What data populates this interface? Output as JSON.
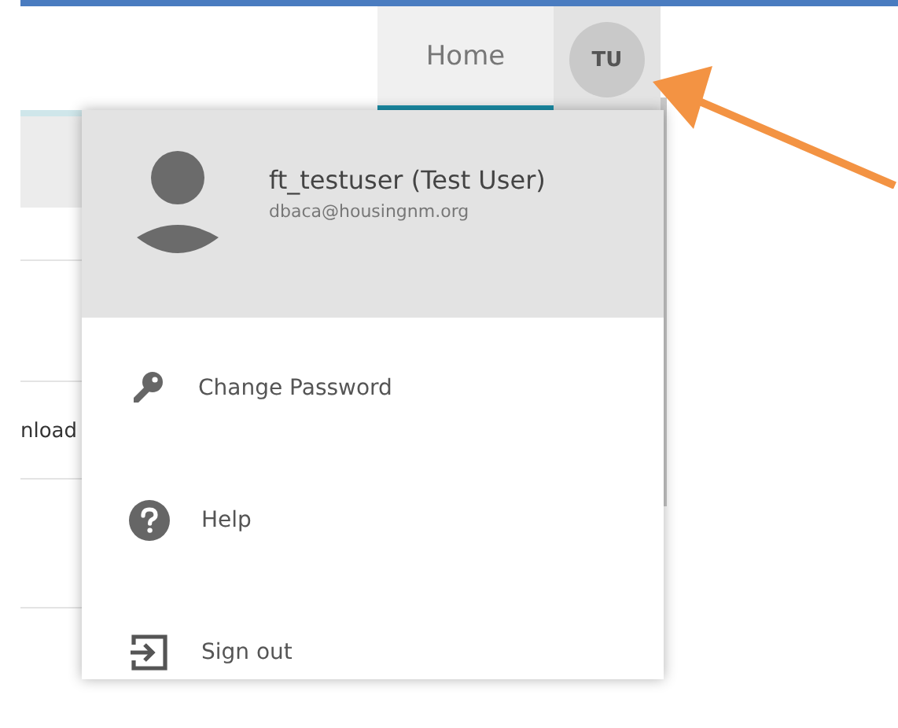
{
  "nav": {
    "tabs": [
      {
        "label": "Home",
        "selected": true
      }
    ],
    "avatar": {
      "initials": "TU"
    }
  },
  "background": {
    "row_text": "nload"
  },
  "user_menu": {
    "name": "ft_testuser (Test User)",
    "email": "dbaca@housingnm.org",
    "items": [
      {
        "label": "Change Password",
        "kind": "key"
      },
      {
        "label": "Help",
        "kind": "help"
      },
      {
        "label": "Sign out",
        "kind": "signout"
      }
    ]
  }
}
